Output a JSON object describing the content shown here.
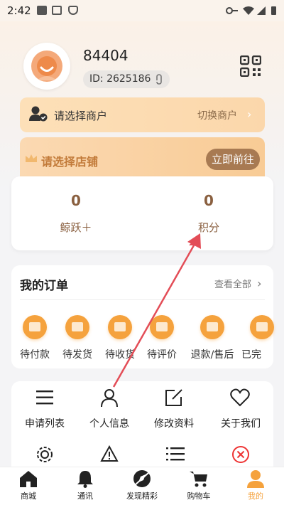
{
  "status_bar": {
    "time": "2:42"
  },
  "profile": {
    "username": "84404",
    "id_text": "ID: 2625186"
  },
  "merchant": {
    "label": "请选择商户",
    "switch_label": "切换商户"
  },
  "store": {
    "label": "请选择店铺",
    "button_label": "立即前往"
  },
  "points": [
    {
      "value": "0",
      "label": "鲸跃＋"
    },
    {
      "value": "0",
      "label": "积分"
    }
  ],
  "orders": {
    "title": "我的订单",
    "view_all": "查看全部",
    "items": [
      {
        "label": "待付款"
      },
      {
        "label": "待发货"
      },
      {
        "label": "待收货"
      },
      {
        "label": "待评价"
      },
      {
        "label": "退款/售后"
      },
      {
        "label": "已完"
      }
    ]
  },
  "tools": {
    "items": [
      {
        "label": "申请列表",
        "icon": "list-icon"
      },
      {
        "label": "个人信息",
        "icon": "person-icon"
      },
      {
        "label": "修改资料",
        "icon": "edit-icon"
      },
      {
        "label": "关于我们",
        "icon": "heart-icon"
      }
    ]
  },
  "nav": {
    "items": [
      {
        "label": "商城",
        "icon": "home-icon"
      },
      {
        "label": "通讯",
        "icon": "bell-icon"
      },
      {
        "label": "发现精彩",
        "icon": "discover-icon"
      },
      {
        "label": "购物车",
        "icon": "cart-icon"
      },
      {
        "label": "我的",
        "icon": "profile-icon",
        "active": true
      }
    ],
    "active_color": "#f5a23d"
  },
  "colors": {
    "accent": "#f5a23d",
    "brown": "#8a6040",
    "store_button": "#a87a52",
    "arrow": "#e34d57"
  }
}
